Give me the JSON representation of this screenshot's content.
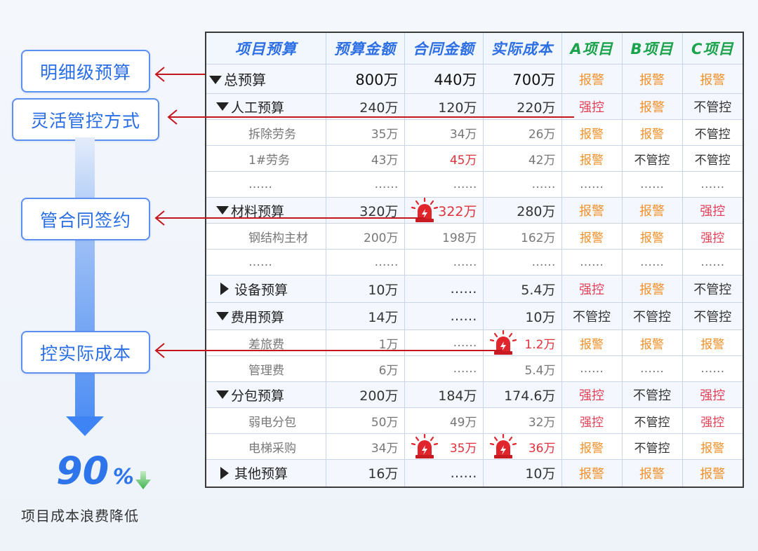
{
  "left": {
    "boxes": [
      "明细级预算",
      "灵活管控方式",
      "管合同签约",
      "控实际成本"
    ],
    "percent_value": "90",
    "percent_symbol": "%",
    "caption": "项目成本浪费降低"
  },
  "table": {
    "headers": [
      "项目预算",
      "预算金额",
      "合同金额",
      "实际成本",
      "A项目",
      "B项目",
      "C项目"
    ],
    "rows": [
      {
        "name": "总预算",
        "budget": "800万",
        "contract": "440万",
        "actual": "700万",
        "a": "报警",
        "b": "报警",
        "c": "报警"
      },
      {
        "name": "人工预算",
        "budget": "240万",
        "contract": "120万",
        "actual": "220万",
        "a": "强控",
        "b": "报警",
        "c": "不管控"
      },
      {
        "name": "拆除劳务",
        "budget": "35万",
        "contract": "34万",
        "actual": "26万",
        "a": "报警",
        "b": "报警",
        "c": "不管控"
      },
      {
        "name": "1#劳务",
        "budget": "43万",
        "contract": "45万",
        "actual": "42万",
        "a": "报警",
        "b": "不管控",
        "c": "不管控"
      },
      {
        "name": "……",
        "budget": "……",
        "contract": "……",
        "actual": "……",
        "a": "……",
        "b": "……",
        "c": "……"
      },
      {
        "name": "材料预算",
        "budget": "320万",
        "contract": "322万",
        "actual": "280万",
        "a": "报警",
        "b": "报警",
        "c": "强控"
      },
      {
        "name": "钢结构主材",
        "budget": "200万",
        "contract": "198万",
        "actual": "162万",
        "a": "报警",
        "b": "报警",
        "c": "强控"
      },
      {
        "name": "……",
        "budget": "……",
        "contract": "……",
        "actual": "……",
        "a": "……",
        "b": "……",
        "c": "……"
      },
      {
        "name": "设备预算",
        "budget": "10万",
        "contract": "……",
        "actual": "5.4万",
        "a": "强控",
        "b": "报警",
        "c": "不管控"
      },
      {
        "name": "费用预算",
        "budget": "14万",
        "contract": "……",
        "actual": "10万",
        "a": "不管控",
        "b": "不管控",
        "c": "不管控"
      },
      {
        "name": "差旅费",
        "budget": "1万",
        "contract": "……",
        "actual": "1.2万",
        "a": "报警",
        "b": "报警",
        "c": "报警"
      },
      {
        "name": "管理费",
        "budget": "6万",
        "contract": "……",
        "actual": "5.4万",
        "a": "……",
        "b": "……",
        "c": "……"
      },
      {
        "name": "分包预算",
        "budget": "200万",
        "contract": "184万",
        "actual": "174.6万",
        "a": "强控",
        "b": "不管控",
        "c": "强控"
      },
      {
        "name": "弱电分包",
        "budget": "50万",
        "contract": "49万",
        "actual": "32万",
        "a": "强控",
        "b": "不管控",
        "c": "强控"
      },
      {
        "name": "电梯采购",
        "budget": "34万",
        "contract": "35万",
        "actual": "36万",
        "a": "报警",
        "b": "不管控",
        "c": "报警"
      },
      {
        "name": "其他预算",
        "budget": "16万",
        "contract": "……",
        "actual": "10万",
        "a": "报警",
        "b": "报警",
        "c": "报警"
      }
    ]
  },
  "colors": {
    "accent_blue": "#2c6fe4",
    "alarm_orange": "#f2902a",
    "strong_red": "#e24157",
    "over_budget_red": "#e0323a",
    "abc_green": "#1aa34a",
    "connector_red": "#c4161c"
  }
}
